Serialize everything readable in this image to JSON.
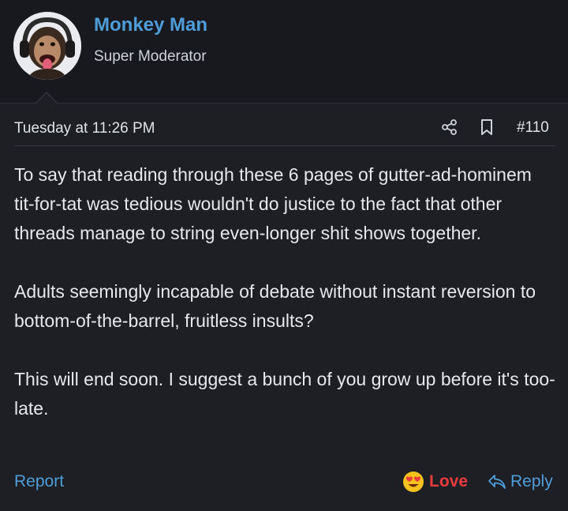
{
  "user": {
    "name": "Monkey Man",
    "title": "Super Moderator",
    "avatar_icon": "chimpanzee-headphones-avatar"
  },
  "post": {
    "date": "Tuesday at 11:26 PM",
    "number": "#110",
    "paragraphs": [
      "To say that reading through these 6 pages of gutter-ad-hominem tit-for-tat was tedious wouldn't do justice to the fact that other threads manage to string even-longer shit shows together.",
      "Adults seemingly incapable of debate without instant reversion to bottom-of-the-barrel, fruitless insults?",
      "This will end soon. I suggest a bunch of you grow up before it's too-late."
    ]
  },
  "actions": {
    "report_label": "Report",
    "love_label": "Love",
    "reply_label": "Reply"
  },
  "icons": {
    "share": "share-icon",
    "bookmark": "bookmark-icon",
    "love": "heart-eyes-emoji-icon",
    "reply": "reply-arrow-icon"
  },
  "colors": {
    "accent": "#4f9dd8",
    "love": "#e83b3b",
    "background": "#1d1f25",
    "header_background": "#17191e"
  }
}
